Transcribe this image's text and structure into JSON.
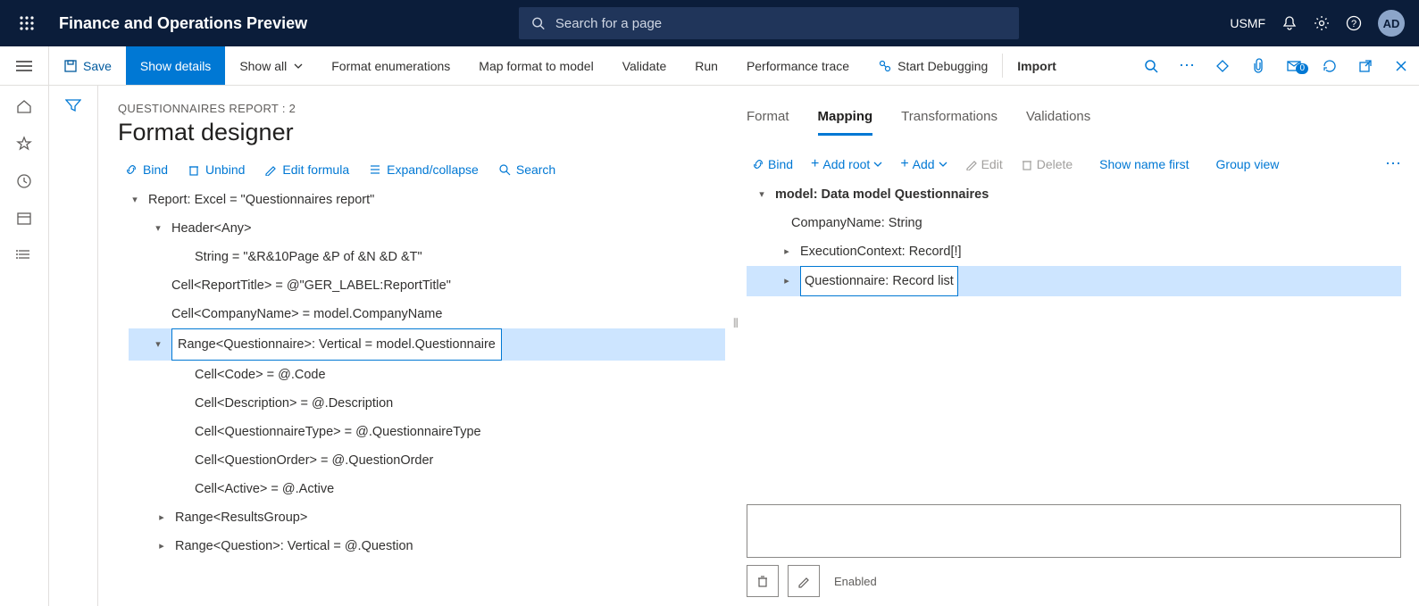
{
  "header": {
    "appTitle": "Finance and Operations Preview",
    "searchPlaceholder": "Search for a page",
    "company": "USMF",
    "avatar": "AD"
  },
  "cmdBar": {
    "save": "Save",
    "showDetails": "Show details",
    "showAll": "Show all",
    "formatEnum": "Format enumerations",
    "mapFormat": "Map format to model",
    "validate": "Validate",
    "run": "Run",
    "perfTrace": "Performance trace",
    "startDebug": "Start Debugging",
    "import": "Import",
    "badge": "0"
  },
  "page": {
    "breadcrumb": "QUESTIONNAIRES REPORT : 2",
    "title": "Format designer"
  },
  "leftToolbar": {
    "bind": "Bind",
    "unbind": "Unbind",
    "editFormula": "Edit formula",
    "expandCollapse": "Expand/collapse",
    "search": "Search"
  },
  "leftTree": {
    "root": "Report: Excel = \"Questionnaires report\"",
    "header": "Header<Any>",
    "headerString": "String = \"&R&10Page &P of &N &D &T\"",
    "cellReportTitle": "Cell<ReportTitle> = @\"GER_LABEL:ReportTitle\"",
    "cellCompany": "Cell<CompanyName> = model.CompanyName",
    "rangeQuestionnaire": "Range<Questionnaire>: Vertical = model.Questionnaire",
    "cellCode": "Cell<Code> = @.Code",
    "cellDescription": "Cell<Description> = @.Description",
    "cellQType": "Cell<QuestionnaireType> = @.QuestionnaireType",
    "cellQOrder": "Cell<QuestionOrder> = @.QuestionOrder",
    "cellActive": "Cell<Active> = @.Active",
    "rangeResults": "Range<ResultsGroup>",
    "rangeQuestion": "Range<Question>: Vertical = @.Question"
  },
  "rightTabs": {
    "format": "Format",
    "mapping": "Mapping",
    "transformations": "Transformations",
    "validations": "Validations"
  },
  "rightToolbar": {
    "bind": "Bind",
    "addRoot": "Add root",
    "add": "Add",
    "edit": "Edit",
    "delete": "Delete",
    "showNameFirst": "Show name first",
    "groupView": "Group view"
  },
  "rightTree": {
    "root": "model: Data model Questionnaires",
    "companyName": "CompanyName: String",
    "execContext": "ExecutionContext: Record[!]",
    "questionnaire": "Questionnaire: Record list"
  },
  "bottom": {
    "enabled": "Enabled"
  }
}
